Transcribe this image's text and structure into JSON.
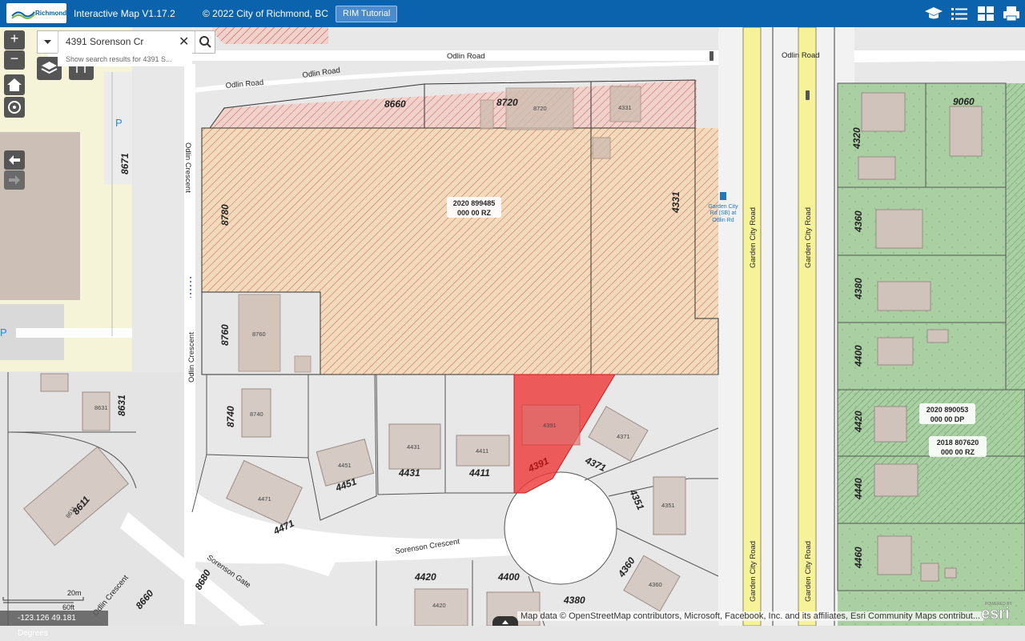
{
  "header": {
    "brand": "Richmond",
    "app_title": "Interactive Map V1.17.2",
    "copyright": "© 2022 City of Richmond, BC",
    "tutorial_button": "RIM Tutorial",
    "icons": [
      "graduation-cap-icon",
      "list-icon",
      "grid-icon",
      "print-icon"
    ]
  },
  "search": {
    "value": "4391 Sorenson Cr",
    "hint": "Show search results for 4391 S..."
  },
  "map_controls": [
    "zoom-in",
    "zoom-out",
    "layers",
    "basemap",
    "home",
    "locate",
    "back",
    "forward"
  ],
  "streets": {
    "odlin_road_top": "Odlin Road",
    "odlin_road_left1": "Odlin Road",
    "odlin_road_left2": "Odlin Road",
    "odlin_road_right": "Odlin Road",
    "odlin_crescent_top": "Odlin Crescent",
    "odlin_crescent_mid": "Odlin Crescent",
    "odlin_crescent_bottom": "Odlin Crescent",
    "garden_city_1": "Garden City Road",
    "garden_city_2": "Garden City Road",
    "garden_city_3": "Garden City Road",
    "garden_city_4": "Garden City Road",
    "sorenson_crescent": "Sorenson Crescent",
    "sorenson_gate": "Sorenson Gate"
  },
  "parcels": {
    "p8660_top": "8660",
    "p8720": "8720",
    "p8780": "8780",
    "p4331": "4331",
    "p8760": "8760",
    "p8740": "8740",
    "p8631": "8631",
    "p8671": "8671",
    "p8611": "8611",
    "p4471": "4471",
    "p4451": "4451",
    "p4431": "4431",
    "p4411": "4411",
    "p4391": "4391",
    "p4371": "4371",
    "p4351": "4351",
    "p4360": "4360",
    "p4380_bot": "4380",
    "p4400_bot": "4400",
    "p4420_bot": "4420",
    "p8680": "8680",
    "p8660_bot": "8660",
    "p9060": "9060",
    "p4320": "4320",
    "p4360_r": "4360",
    "p4380_r": "4380",
    "p4400_r": "4400",
    "p4420_r": "4420",
    "p4440_r": "4440",
    "p4460_r": "4460"
  },
  "building_labels": {
    "b8720": "8720",
    "b4331": "4331",
    "b8760": "8760",
    "b8740": "8740",
    "b8631": "8631",
    "b8611": "8611",
    "b4471": "4471",
    "b4451": "4451",
    "b4431": "4431",
    "b4411": "4411",
    "b4391": "4391",
    "b4371": "4371",
    "b4351": "4351",
    "b4360": "4360",
    "b4420": "4420"
  },
  "zoning": {
    "rz_main": [
      "2020 899485",
      "000 00 RZ"
    ],
    "dp_right": [
      "2020 890053",
      "000 00 DP"
    ],
    "rz_right": [
      "2018 807620",
      "000 00 RZ"
    ]
  },
  "bus_stop": [
    "Garden City",
    "Rd (SB) at",
    "Odlin Rd"
  ],
  "parking": "P",
  "scale": {
    "metric": "20m",
    "imperial": "60ft"
  },
  "coordinates": "-123.126 49.181 Degrees",
  "attribution": "Map data © OpenStreetMap contributors, Microsoft, Facebook, Inc. and its affiliates, Esri Community Maps contribut...",
  "esri": {
    "powered": "POWERED BY",
    "name": "esri"
  },
  "colors": {
    "header": "#0b63ad",
    "selected_parcel": "#ee3b3b",
    "rz_hatch": "#b8453c",
    "green_lot": "#9cc29a"
  }
}
